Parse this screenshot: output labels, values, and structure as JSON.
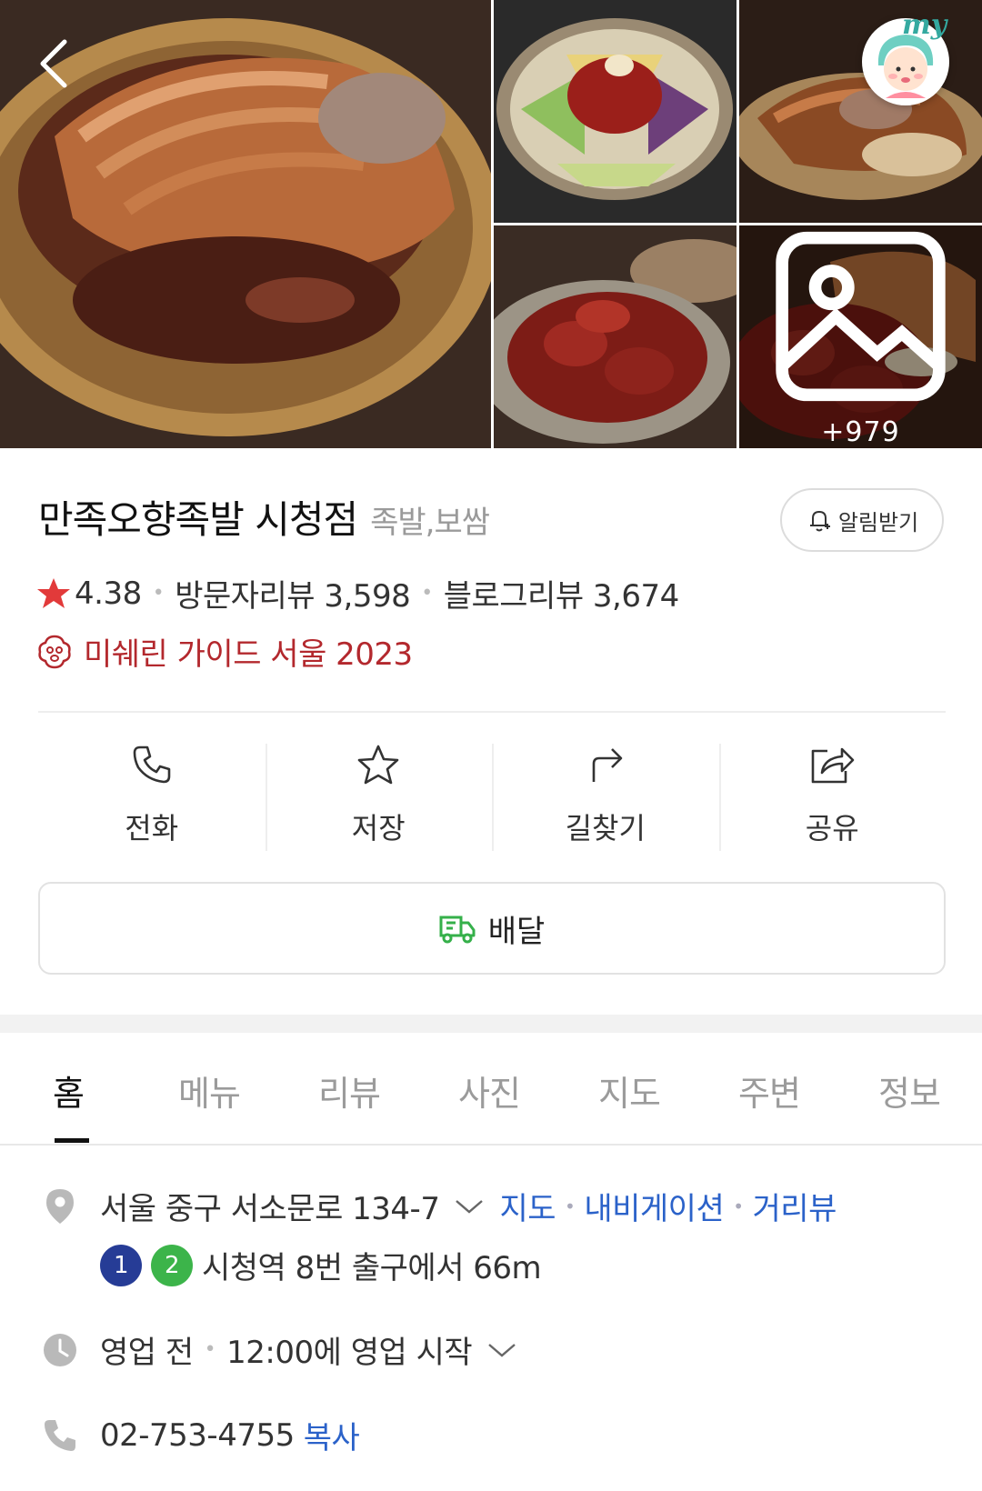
{
  "gallery": {
    "more_count": "+979"
  },
  "header": {
    "my_label": "my"
  },
  "place": {
    "name": "만족오향족발 시청점",
    "category": "족발,보쌈",
    "alarm_label": "알림받기",
    "rating": "4.38",
    "visitor_reviews": "방문자리뷰 3,598",
    "blog_reviews": "블로그리뷰 3,674",
    "michelin": "미쉐린 가이드 서울 2023"
  },
  "actions": [
    {
      "label": "전화",
      "icon": "phone-icon"
    },
    {
      "label": "저장",
      "icon": "star-icon"
    },
    {
      "label": "길찾기",
      "icon": "directions-icon"
    },
    {
      "label": "공유",
      "icon": "share-icon"
    }
  ],
  "delivery": {
    "label": "배달"
  },
  "tabs": [
    {
      "label": "홈",
      "active": true
    },
    {
      "label": "메뉴"
    },
    {
      "label": "리뷰"
    },
    {
      "label": "사진"
    },
    {
      "label": "지도"
    },
    {
      "label": "주변"
    },
    {
      "label": "정보"
    }
  ],
  "info": {
    "address": "서울 중구 서소문로 134-7",
    "map_link": "지도",
    "navigation_link": "내비게이션",
    "streetview_link": "거리뷰",
    "subway_line_1": "1",
    "subway_line_2": "2",
    "subway_text": "시청역 8번 출구에서 66m",
    "hours_status": "영업 전",
    "hours_detail": "12:00에 영업 시작",
    "phone": "02-753-4755",
    "copy_label": "복사"
  },
  "colors": {
    "link": "#2b62c9",
    "michelin": "#b3282d",
    "rating_star": "#e23a3a",
    "line1": "#263c96",
    "line2": "#3cb44a",
    "delivery_green": "#35b04a"
  }
}
